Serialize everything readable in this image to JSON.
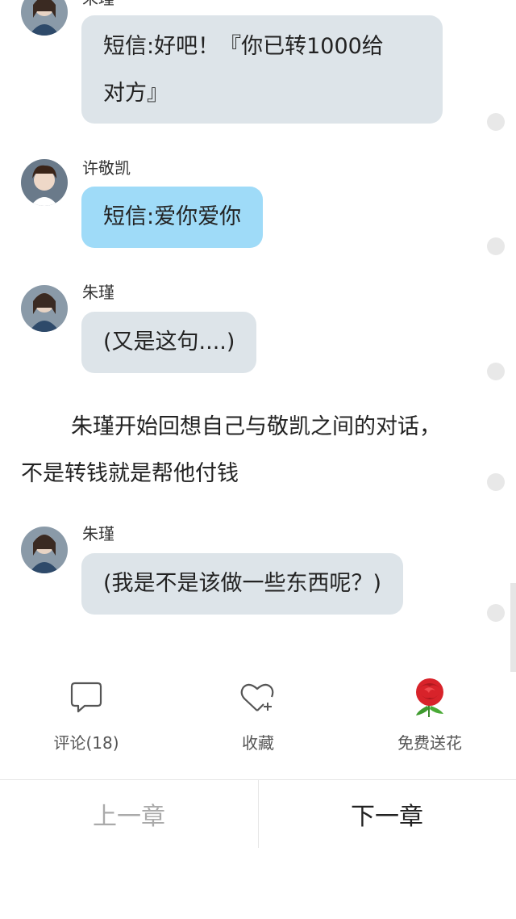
{
  "messages": [
    {
      "sender": "朱瑾",
      "line1": "短信:好吧！『你已转1000给",
      "line2": "对方』"
    },
    {
      "sender": "许敬凯",
      "text": "短信:爱你爱你"
    },
    {
      "sender": "朱瑾",
      "text": "(又是这句....)"
    },
    {
      "sender": "朱瑾",
      "text": "(我是不是该做一些东西呢？)"
    }
  ],
  "narration": "朱瑾开始回想自己与敬凯之间的对话，不是转钱就是帮他付钱",
  "actions": {
    "comment": {
      "label": "评论(18)",
      "icon": "comment-bubble-icon"
    },
    "favorite": {
      "label": "收藏",
      "icon": "heart-plus-icon"
    },
    "flower": {
      "label": "免费送花",
      "icon": "rose-icon"
    }
  },
  "nav": {
    "prev": "上一章",
    "next": "下一章"
  },
  "colors": {
    "bubble_grey": "#dde4e9",
    "bubble_blue": "#9fdbf8",
    "disabled_text": "#aaaaaa"
  }
}
